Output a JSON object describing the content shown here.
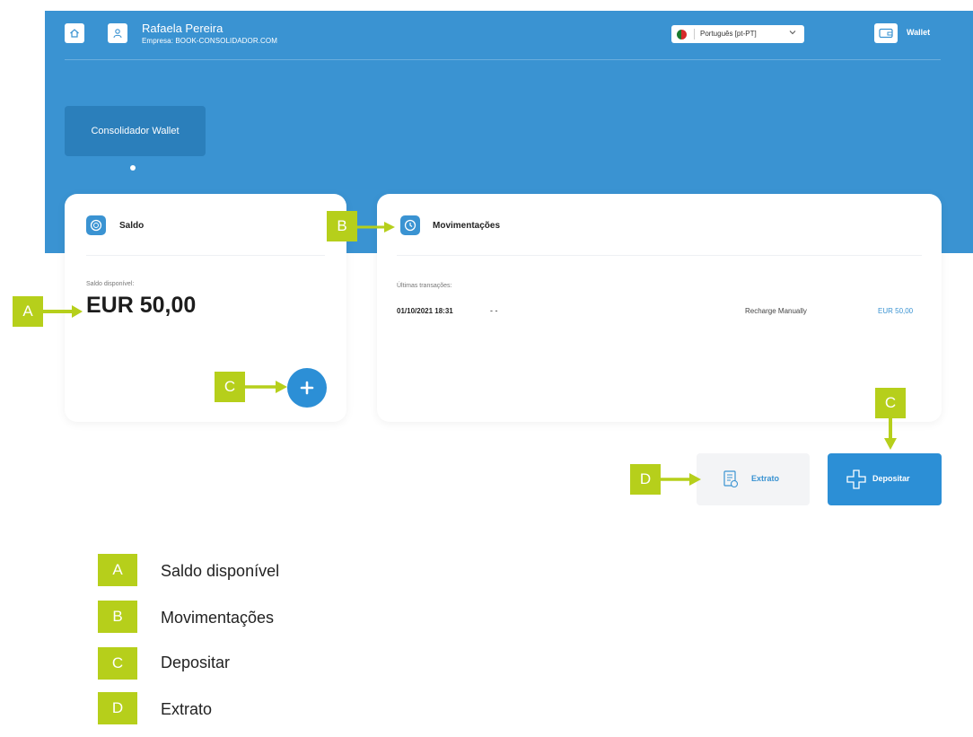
{
  "header": {
    "user_name": "Rafaela Pereira",
    "company": "Empresa: BOOK-CONSOLIDADOR.COM",
    "language": "Português [pt-PT]",
    "wallet_label": "Wallet"
  },
  "wallet_tab": {
    "label": "Consolidador Wallet"
  },
  "saldo_card": {
    "title": "Saldo",
    "available_label": "Saldo disponível:",
    "balance": "EUR 50,00"
  },
  "movimentacoes_card": {
    "title": "Movimentações",
    "recent_label": "Últimas transações:",
    "transactions": [
      {
        "date": "01/10/2021 18:31",
        "ref": "- -",
        "description": "Recharge Manually",
        "amount": "EUR 50,00"
      }
    ]
  },
  "actions": {
    "extrato_label": "Extrato",
    "depositar_label": "Depositar"
  },
  "annotations": {
    "tags": [
      "A",
      "B",
      "C",
      "C",
      "D"
    ],
    "legend": [
      {
        "letter": "A",
        "text": "Saldo disponível"
      },
      {
        "letter": "B",
        "text": "Movimentações"
      },
      {
        "letter": "C",
        "text": "Depositar"
      },
      {
        "letter": "D",
        "text": "Extrato"
      }
    ]
  },
  "colors": {
    "primary": "#3a93d2",
    "button_blue": "#2c8fd6",
    "tab_dark": "#2b7fbb",
    "annotation_green": "#b6cf1b"
  },
  "icons": [
    "home-icon",
    "user-icon",
    "flag-icon",
    "chevron-down-icon",
    "wallet-icon",
    "coin-icon",
    "clock-icon",
    "plus-icon",
    "receipt-icon",
    "arrow-right-icon",
    "arrow-down-icon"
  ]
}
